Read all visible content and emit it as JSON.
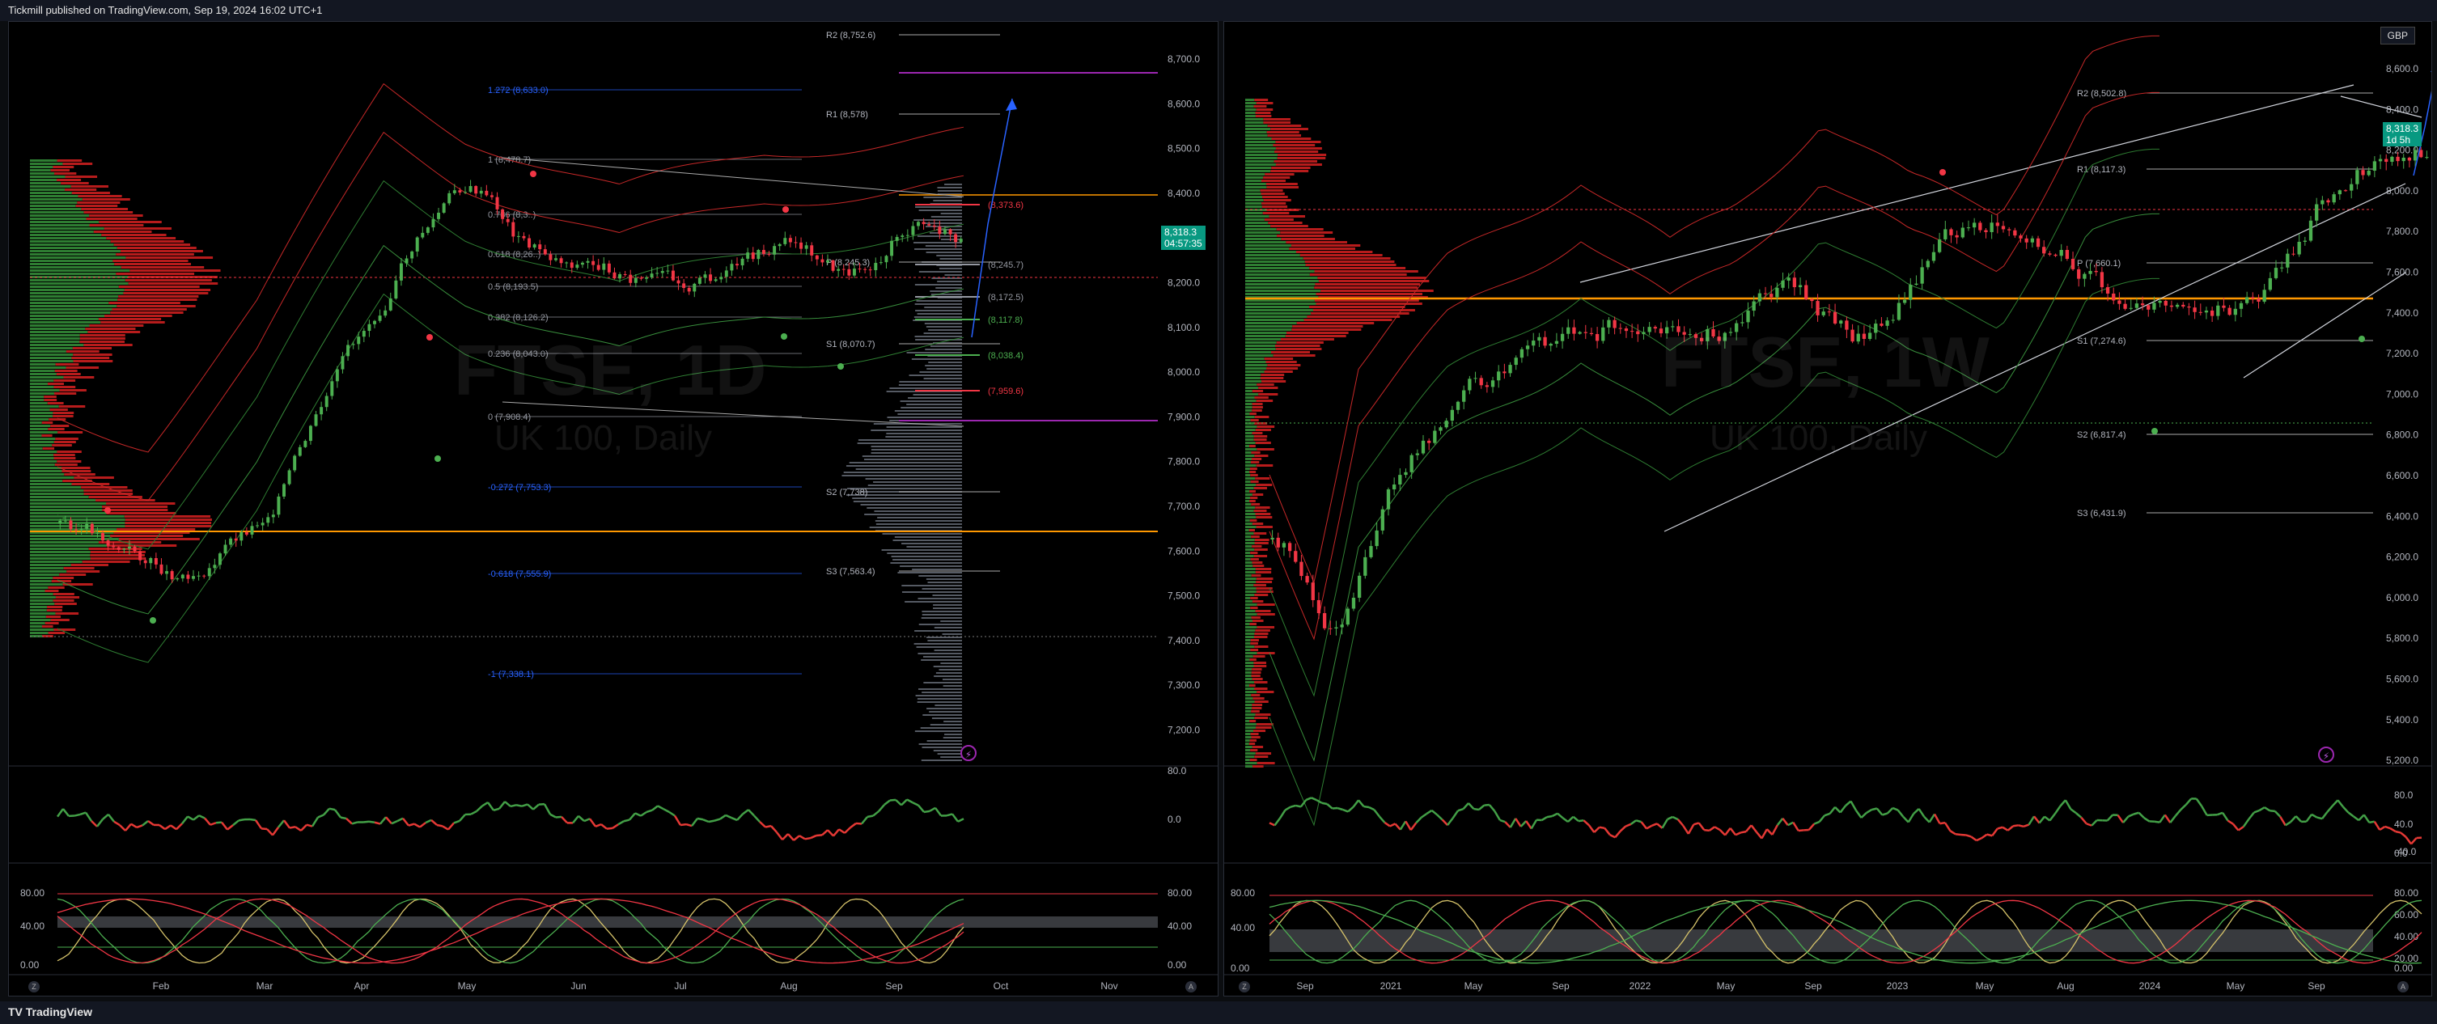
{
  "header": {
    "publisher_line": "Tickmill published on TradingView.com, Sep 19, 2024 16:02 UTC+1"
  },
  "footer": {
    "brand": "TradingView",
    "brand_mark": "TV"
  },
  "left_chart": {
    "watermark_symbol": "FTSE, 1D",
    "watermark_name": "UK 100, Daily",
    "price_axis": [
      "8,700.0",
      "8,600.0",
      "8,500.0",
      "8,400.0",
      "8,300.0",
      "8,200.0",
      "8,100.0",
      "8,000.0",
      "7,900.0",
      "7,800.0",
      "7,700.0",
      "7,600.0",
      "7,500.0",
      "7,400.0",
      "7,300.0",
      "7,200.0"
    ],
    "last_price": "8,318.3",
    "countdown": "04:57:35",
    "pivot_labels": [
      "R2 (8,752.6)",
      "R1 (8,578)",
      "P (8,245.3)",
      "S1 (8,070.7)",
      "S2 (7,738)",
      "S3 (7,563.4)"
    ],
    "fib_labels": [
      "1.272 (8,633.0)",
      "1 (8,478.7)",
      "0.786 (8,3..)",
      "0.618 (8,26..)",
      "0.5 (8,193.5)",
      "0.382 (8,126.2)",
      "0.236 (8,043.0)",
      "0 (7,908.4)",
      "-0.272 (7,753.3)",
      "-0.618 (7,555.9)",
      "-1 (7,338.1)"
    ],
    "level_labels": [
      "(8,373.6)",
      "(8,245.7)",
      "(8,172.5)",
      "(8,117.8)",
      "(8,038.4)",
      "(7,959.6)"
    ],
    "osc1_axis": [
      "80.0",
      "0.0"
    ],
    "osc2_axis": [
      "80.00",
      "40.00",
      "0.00"
    ],
    "time_axis": [
      "Feb",
      "Mar",
      "Apr",
      "May",
      "Jun",
      "Jul",
      "Aug",
      "Sep",
      "Oct",
      "Nov"
    ],
    "corner_left": "Z",
    "corner_right": "A"
  },
  "right_chart": {
    "currency": "GBP",
    "watermark_symbol": "FTSE, 1W",
    "watermark_name": "UK 100, Daily",
    "price_axis": [
      "8,600.0",
      "8,400.0",
      "8,200.0",
      "8,000.0",
      "7,800.0",
      "7,600.0",
      "7,400.0",
      "7,200.0",
      "7,000.0",
      "6,800.0",
      "6,600.0",
      "6,400.0",
      "6,200.0",
      "6,000.0",
      "5,800.0",
      "5,600.0",
      "5,400.0",
      "5,200.0"
    ],
    "last_price": "8,318.3",
    "countdown": "1d 5h",
    "pivot_labels": [
      "R2 (8,502.8)",
      "R1 (8,117.3)",
      "P (7,660.1)",
      "S1 (7,274.6)",
      "S2 (6,817.4)",
      "S3 (6,431.9)"
    ],
    "osc1_axis": [
      "80.0",
      "40.0",
      "0.0",
      "-40.0"
    ],
    "osc2_axis": [
      "80.00",
      "60.00",
      "40.00",
      "20.00",
      "0.00"
    ],
    "time_axis": [
      "Sep",
      "2021",
      "May",
      "Sep",
      "2022",
      "May",
      "Sep",
      "2023",
      "May",
      "Aug",
      "2024",
      "May",
      "Sep"
    ],
    "corner_left": "Z",
    "corner_right": "A"
  },
  "colors": {
    "up": "#4caf50",
    "down": "#f23645",
    "volume_profile_up": "#2e7d32",
    "volume_profile_down": "#b71c1c",
    "orange_line": "#ff9800",
    "magenta_line": "#9c27b0",
    "fib_blue": "#2962ff"
  }
}
